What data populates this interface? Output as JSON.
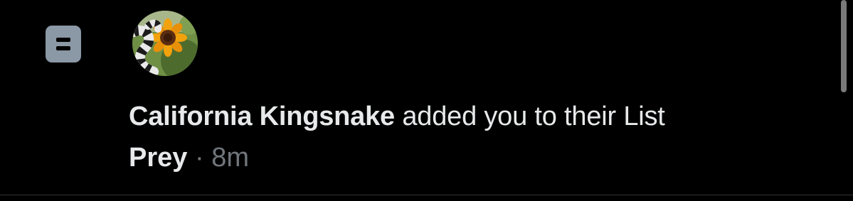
{
  "notification": {
    "type_icon": "list-icon",
    "avatar_icon": "snake-sunflower-avatar",
    "user_name": "California Kingsnake",
    "action_text": " added you to their List",
    "list_name": "Prey",
    "separator": " · ",
    "timestamp": "8m"
  },
  "colors": {
    "background": "#000000",
    "primary_text": "#e7e9ea",
    "secondary_text": "#71767b",
    "icon_bg": "#8b98a5",
    "divider": "#2f3336"
  }
}
